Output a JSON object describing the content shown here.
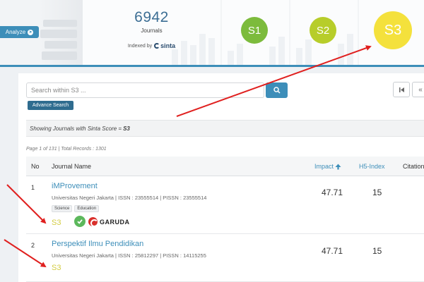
{
  "header": {
    "analyze_label": "Analyze",
    "journals_count": "6942",
    "journals_label": "Journals",
    "indexed_by": "Indexed by",
    "sinta_logo_text": "sinta",
    "scores": [
      "S1",
      "S2",
      "S3"
    ]
  },
  "search": {
    "placeholder": "Search within S3 ...",
    "advance_label": "Advance Search"
  },
  "filter": {
    "text": "Showing Journals with Sinta Score = ",
    "value": "S3"
  },
  "page_info": "Page 1 of 131 | Total Records : 1301",
  "table": {
    "headers": {
      "no": "No",
      "name": "Journal Name",
      "impact": "Impact",
      "h5": "H5-Index",
      "citations": "Citation"
    },
    "rows": [
      {
        "no": "1",
        "title": "iMProvement",
        "meta": "Universitas Negeri Jakarta | ISSN : 23555514 | PISSN : 23555514",
        "tags": [
          "Science",
          "Education"
        ],
        "score": "S3",
        "impact": "47.71",
        "h5": "15",
        "garuda": "GARUDA"
      },
      {
        "no": "2",
        "title": "Perspektif Ilmu Pendidikan",
        "meta": "Universitas Negeri Jakarta | ISSN : 25812297 | PISSN : 14115255",
        "score": "S3",
        "impact": "47.71",
        "h5": "15"
      }
    ]
  },
  "colors": {
    "accent": "#3d8eb9",
    "s1": "#7cbb3c",
    "s2": "#b7cd2a",
    "s3": "#f4e13c",
    "annotation_arrow": "#e0201f"
  }
}
